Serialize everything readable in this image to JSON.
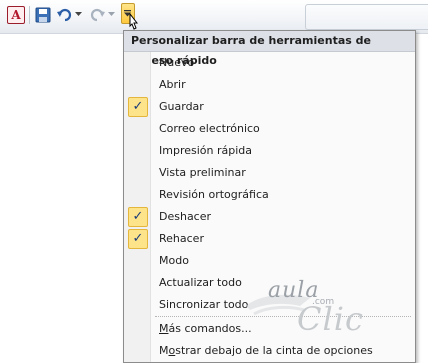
{
  "menu": {
    "title": "Personalizar barra de herramientas de acceso rápido",
    "items": [
      {
        "label": "Nuevo",
        "checked": false
      },
      {
        "label": "Abrir",
        "checked": false
      },
      {
        "label": "Guardar",
        "checked": true
      },
      {
        "label": "Correo electrónico",
        "checked": false
      },
      {
        "label": "Impresión rápida",
        "checked": false
      },
      {
        "label": "Vista preliminar",
        "checked": false
      },
      {
        "label": "Revisión ortográfica",
        "checked": false
      },
      {
        "label": "Deshacer",
        "checked": true
      },
      {
        "label": "Rehacer",
        "checked": true
      },
      {
        "label": "Modo",
        "checked": false
      },
      {
        "label": "Actualizar todo",
        "checked": false
      },
      {
        "label": "Sincronizar todo",
        "checked": false
      }
    ],
    "more_commands": {
      "pre": "",
      "accel": "M",
      "post": "ás comandos..."
    },
    "show_below": {
      "pre": "M",
      "accel": "o",
      "post": "strar debajo de la cinta de opciones"
    },
    "check_glyph": "✓"
  },
  "toolbar": {
    "app_logo": "A",
    "icons": [
      "access-logo",
      "save-icon",
      "undo-icon",
      "redo-icon",
      "customize-dropdown-icon"
    ]
  },
  "watermark": {
    "aula": "aula",
    "com": ".com",
    "clic": "Clic"
  },
  "colors": {
    "check_bg": "#fde38a",
    "title_bg": "#dde1e7",
    "customize_bg": "#ffc93f"
  }
}
